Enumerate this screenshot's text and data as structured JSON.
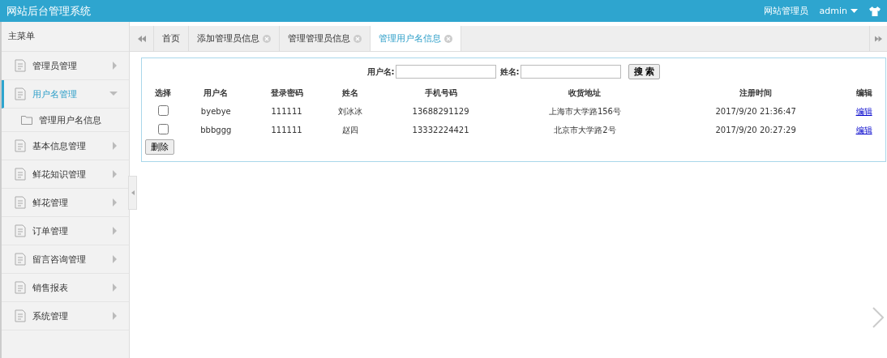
{
  "header": {
    "title": "网站后台管理系统",
    "role": "网站管理员",
    "user": "admin"
  },
  "sidebar": {
    "title": "主菜单",
    "items": [
      {
        "label": "管理员管理",
        "expanded": false,
        "selected": false
      },
      {
        "label": "用户名管理",
        "expanded": true,
        "selected": true,
        "children": [
          {
            "label": "管理用户名信息"
          }
        ]
      },
      {
        "label": "基本信息管理",
        "expanded": false,
        "selected": false
      },
      {
        "label": "鲜花知识管理",
        "expanded": false,
        "selected": false
      },
      {
        "label": "鲜花管理",
        "expanded": false,
        "selected": false
      },
      {
        "label": "订单管理",
        "expanded": false,
        "selected": false
      },
      {
        "label": "留言咨询管理",
        "expanded": false,
        "selected": false
      },
      {
        "label": "销售报表",
        "expanded": false,
        "selected": false
      },
      {
        "label": "系统管理",
        "expanded": false,
        "selected": false
      }
    ]
  },
  "tabs": [
    {
      "label": "首页",
      "closable": false,
      "selected": false
    },
    {
      "label": "添加管理员信息",
      "closable": true,
      "selected": false
    },
    {
      "label": "管理管理员信息",
      "closable": true,
      "selected": false
    },
    {
      "label": "管理用户名信息",
      "closable": true,
      "selected": true
    }
  ],
  "search": {
    "username_label": "用户名:",
    "name_label": "姓名:",
    "button": "搜 索"
  },
  "table": {
    "columns": [
      "选择",
      "用户名",
      "登录密码",
      "姓名",
      "手机号码",
      "收货地址",
      "注册时间",
      "编辑"
    ],
    "rows": [
      {
        "checked": false,
        "cells": [
          "",
          "byebye",
          "111111",
          "刘冰冰",
          "13688291129",
          "上海市大学路156号",
          "2017/9/20 21:36:47",
          "编辑"
        ]
      },
      {
        "checked": false,
        "cells": [
          "",
          "bbbggg",
          "111111",
          "赵四",
          "13332224421",
          "北京市大学路2号",
          "2017/9/20 20:27:29",
          "编辑"
        ]
      }
    ]
  },
  "delete_button": "删除"
}
